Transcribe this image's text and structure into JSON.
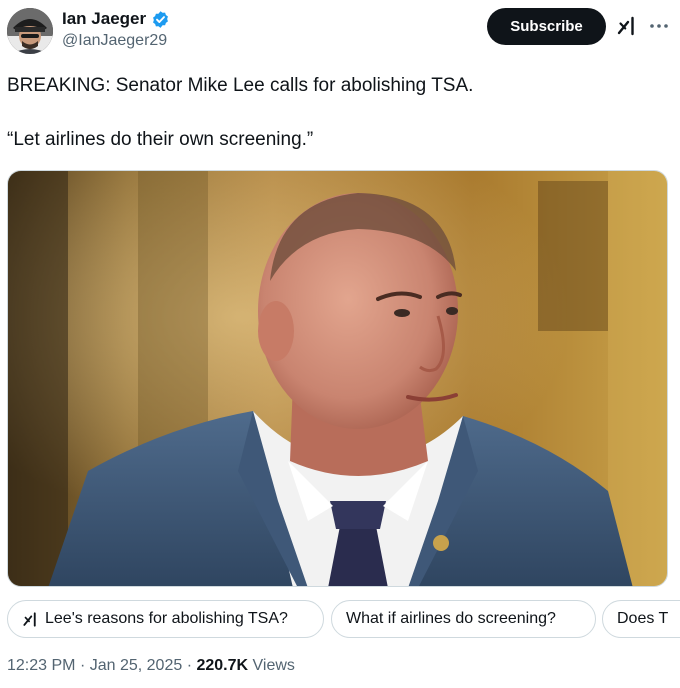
{
  "author": {
    "display_name": "Ian Jaeger",
    "handle": "@IanJaeger29",
    "verified": true,
    "avatar_icon": "avatar"
  },
  "actions": {
    "subscribe_label": "Subscribe",
    "grok_icon": "grok-icon",
    "more_icon": "more-icon"
  },
  "tweet": {
    "line1": "BREAKING: Senator Mike Lee calls for abolishing TSA.",
    "line2": "“Let airlines do their own screening.”"
  },
  "media": {
    "type": "photo"
  },
  "suggestions": [
    {
      "label": "Lee's reasons for abolishing TSA?",
      "icon": "grok-icon"
    },
    {
      "label": "What if airlines do screening?"
    },
    {
      "label": "Does T"
    }
  ],
  "meta": {
    "time": "12:23 PM",
    "date": "Jan 25, 2025",
    "views_count": "220.7K",
    "views_label": "Views"
  },
  "colors": {
    "text": "#0f1419",
    "secondary": "#536471",
    "verified_blue": "#1d9bf0",
    "button_bg": "#0f1419",
    "border": "#cfd9de"
  }
}
